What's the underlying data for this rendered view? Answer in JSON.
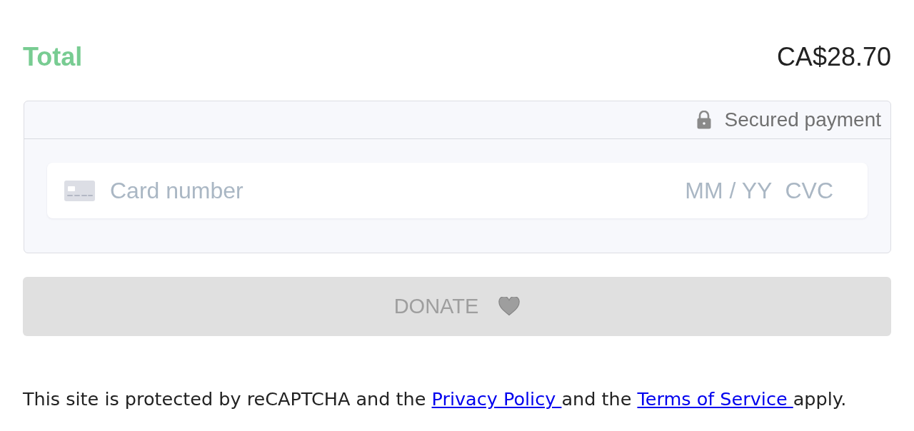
{
  "total": {
    "label": "Total",
    "amount": "CA$28.70"
  },
  "payment": {
    "secure_label": "Secured payment",
    "card_number": {
      "placeholder": "Card number"
    },
    "expiry": {
      "placeholder": "MM / YY"
    },
    "cvc": {
      "placeholder": "CVC"
    }
  },
  "donate_button": {
    "label": "DONATE",
    "disabled": true
  },
  "notice": {
    "parts": [
      {
        "kind": "text",
        "text": "This site is protected by reCAPTCHA and the "
      },
      {
        "kind": "link",
        "text": "Privacy Policy "
      },
      {
        "kind": "text",
        "text": "and the "
      },
      {
        "kind": "link",
        "text": "Terms of Service "
      },
      {
        "kind": "text",
        "text": "apply."
      }
    ]
  }
}
